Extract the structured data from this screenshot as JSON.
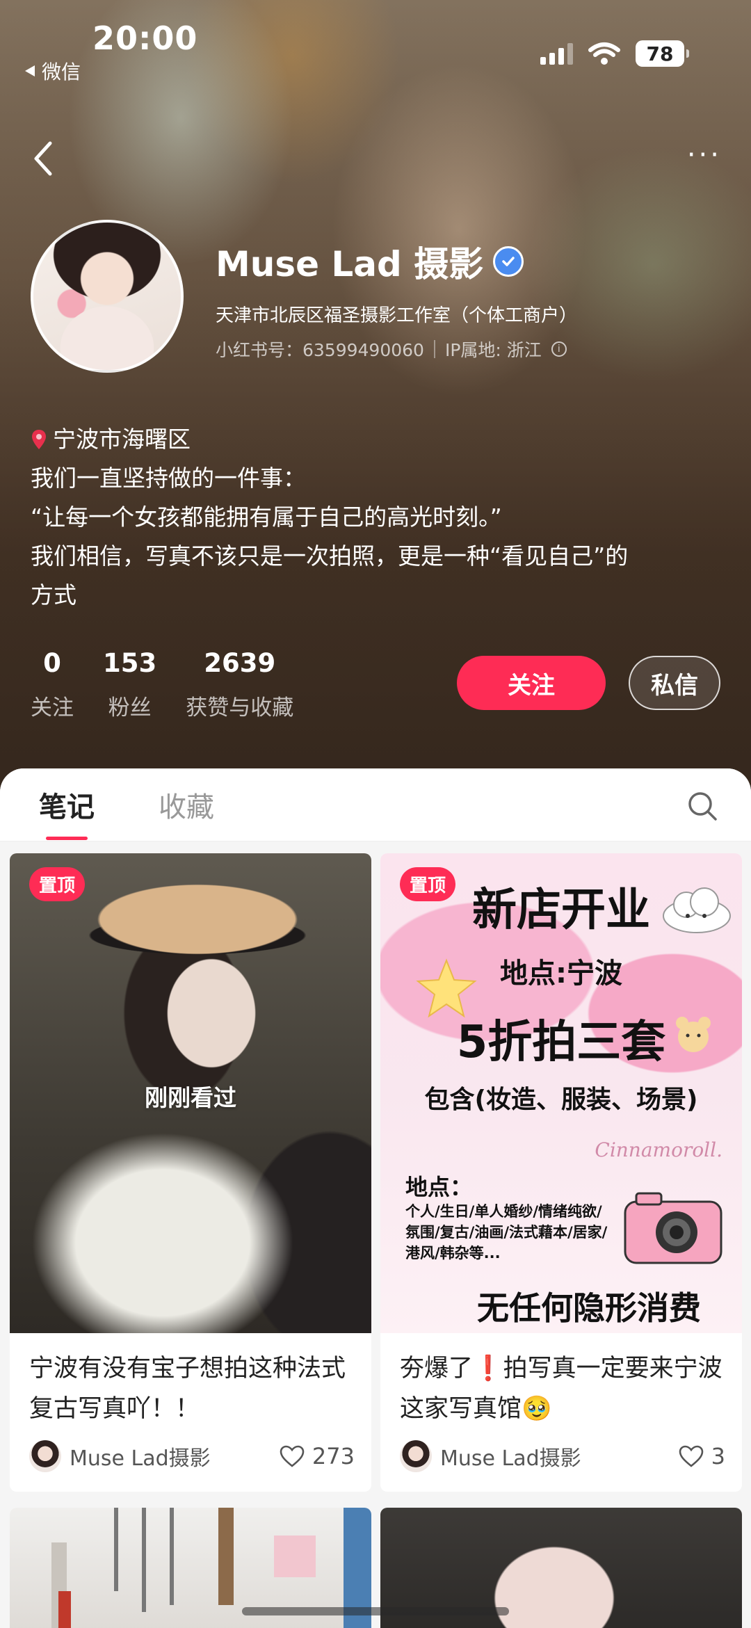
{
  "status_bar": {
    "time": "20:00",
    "back_app": "微信",
    "battery": "78"
  },
  "profile": {
    "name": "Muse Lad 摄影",
    "subtitle": "天津市北辰区福圣摄影工作室（个体工商户）",
    "id_label": "小红书号：63599490060",
    "ip_label": "IP属地: 浙江",
    "location": "宁波市海曙区",
    "bio_lines": [
      "我们一直坚持做的一件事：",
      "“让每一个女孩都能拥有属于自己的高光时刻。”",
      "我们相信，写真不该只是一次拍照，更是一种“看见自己”的",
      "方式"
    ],
    "stats": [
      {
        "num": "0",
        "label": "关注"
      },
      {
        "num": "153",
        "label": "粉丝"
      },
      {
        "num": "2639",
        "label": "获赞与收藏"
      }
    ],
    "follow_label": "关注",
    "message_label": "私信"
  },
  "tabs": [
    {
      "label": "笔记",
      "active": true
    },
    {
      "label": "收藏",
      "active": false
    }
  ],
  "notes": [
    {
      "badge": "置顶",
      "overlay": "刚刚看过",
      "title": "宁波有没有宝子想拍这种法式复古写真吖！！",
      "author": "Muse Lad摄影",
      "likes": "273"
    },
    {
      "badge": "置顶",
      "title": "夯爆了❗️拍写真一定要来宁波这家写真馆🥹",
      "author": "Muse Lad摄影",
      "likes": "3",
      "poster": {
        "headline": "新店开业",
        "place": "地点:宁波",
        "deal": "5折拍三套",
        "includes": "包含(妆造、服装、场景)",
        "loc_label": "地点：",
        "list": "个人/生日/单人婚纱/情绪纯欲/氛围/复古/油画/法式藉本/居家/港风/韩杂等...",
        "footer": "无任何隐形消费",
        "brand": "Cinnamoroll."
      }
    }
  ],
  "colors": {
    "accent": "#fe2c55",
    "verified": "#4a8cf0"
  }
}
